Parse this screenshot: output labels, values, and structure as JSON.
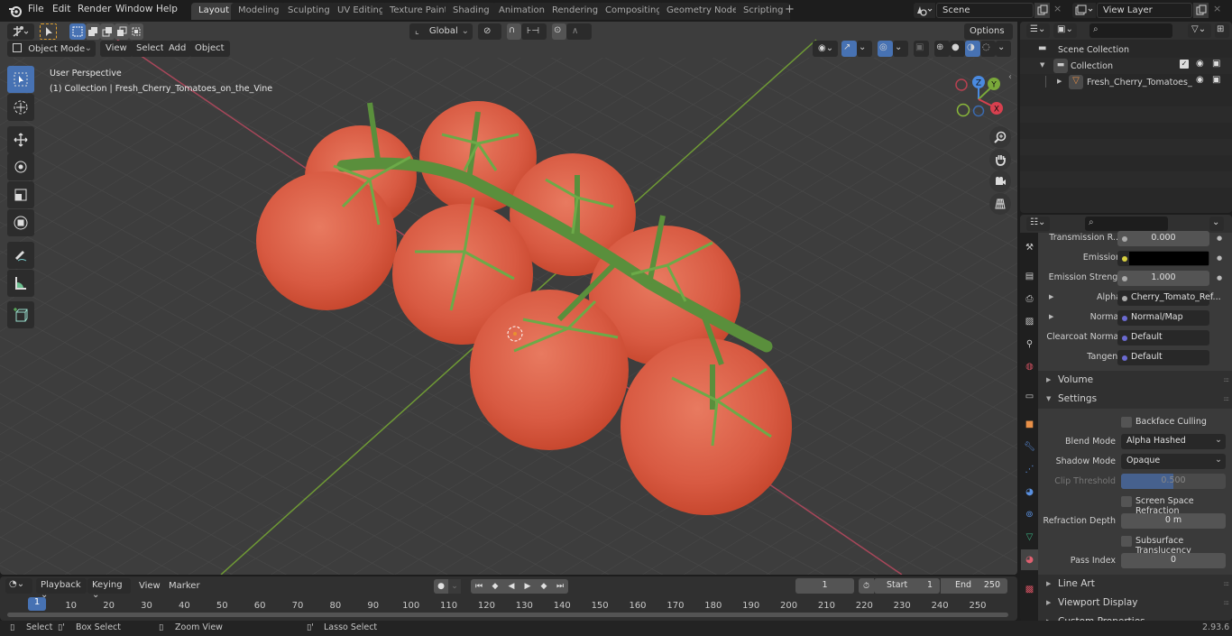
{
  "topbar": {
    "menus": [
      "File",
      "Edit",
      "Render",
      "Window",
      "Help"
    ],
    "workspaces": [
      {
        "label": "Layout",
        "active": true
      },
      {
        "label": "Modeling",
        "active": false
      },
      {
        "label": "Sculpting",
        "active": false
      },
      {
        "label": "UV Editing",
        "active": false
      },
      {
        "label": "Texture Paint",
        "active": false
      },
      {
        "label": "Shading",
        "active": false
      },
      {
        "label": "Animation",
        "active": false
      },
      {
        "label": "Rendering",
        "active": false
      },
      {
        "label": "Compositing",
        "active": false
      },
      {
        "label": "Geometry Nodes",
        "active": false
      },
      {
        "label": "Scripting",
        "active": false
      }
    ],
    "add_workspace": "+",
    "scene": "Scene",
    "view_layer": "View Layer"
  },
  "viewport": {
    "mode": "Object Mode",
    "menus": [
      "View",
      "Select",
      "Add",
      "Object"
    ],
    "orientation": "Global",
    "options_label": "Options",
    "overlay_title": "User Perspective",
    "overlay_subtitle": "(1) Collection | Fresh_Cherry_Tomatoes_on_the_Vine",
    "gizmo_axes": {
      "x": "X",
      "y": "Y",
      "z": "Z"
    },
    "colors": {
      "background": "#3d3d3d",
      "x_axis": "#c84a5a",
      "y_axis": "#7aa83a",
      "tomato": "#e06048",
      "vine": "#5fa044",
      "accent": "#4772b3"
    }
  },
  "outliner": {
    "search_placeholder": "",
    "items": [
      {
        "label": "Scene Collection",
        "level": 0
      },
      {
        "label": "Collection",
        "level": 1
      },
      {
        "label": "Fresh_Cherry_Tomatoes_",
        "level": 2
      }
    ]
  },
  "properties": {
    "search_placeholder": "",
    "rows": [
      {
        "label": "Transmission R...",
        "value": "0.000",
        "kind": "number"
      },
      {
        "label": "Emission",
        "value": "",
        "kind": "color",
        "color": "#000000"
      },
      {
        "label": "Emission Strengt",
        "value": "1.000",
        "kind": "number"
      },
      {
        "label": "Alpha",
        "value": "Cherry_Tomato_Ref...",
        "kind": "link"
      },
      {
        "label": "Normal",
        "value": "Normal/Map",
        "kind": "link"
      },
      {
        "label": "Clearcoat Normal",
        "value": "Default",
        "kind": "link"
      },
      {
        "label": "Tangent",
        "value": "Default",
        "kind": "link"
      }
    ],
    "sections": {
      "volume": "Volume",
      "settings": "Settings",
      "line_art": "Line Art",
      "viewport_display": "Viewport Display",
      "custom_props": "Custom Properties"
    },
    "settings": {
      "backface_culling": {
        "label": "Backface Culling",
        "checked": false
      },
      "blend_mode": {
        "label": "Blend Mode",
        "value": "Alpha Hashed"
      },
      "shadow_mode": {
        "label": "Shadow Mode",
        "value": "Opaque"
      },
      "clip_threshold": {
        "label": "Clip Threshold",
        "value": "0.500",
        "fraction": 0.5
      },
      "screen_space_refraction": {
        "label": "Screen Space Refraction",
        "checked": false
      },
      "refraction_depth": {
        "label": "Refraction Depth",
        "value": "0 m"
      },
      "subsurface_translucency": {
        "label": "Subsurface Translucency",
        "checked": false
      },
      "pass_index": {
        "label": "Pass Index",
        "value": "0"
      }
    }
  },
  "timeline": {
    "menus": [
      "Playback",
      "Keying",
      "View",
      "Marker"
    ],
    "current_frame": "1",
    "start_label": "Start",
    "start": "1",
    "end_label": "End",
    "end": "250",
    "ticks": [
      "10",
      "20",
      "30",
      "40",
      "50",
      "60",
      "70",
      "80",
      "90",
      "100",
      "110",
      "120",
      "130",
      "140",
      "150",
      "160",
      "170",
      "180",
      "190",
      "200",
      "210",
      "220",
      "230",
      "240",
      "250"
    ],
    "playhead_label": "1"
  },
  "statusbar": {
    "hints": [
      "Select",
      "Box Select",
      "Zoom View",
      "Lasso Select"
    ],
    "version": "2.93.6"
  }
}
